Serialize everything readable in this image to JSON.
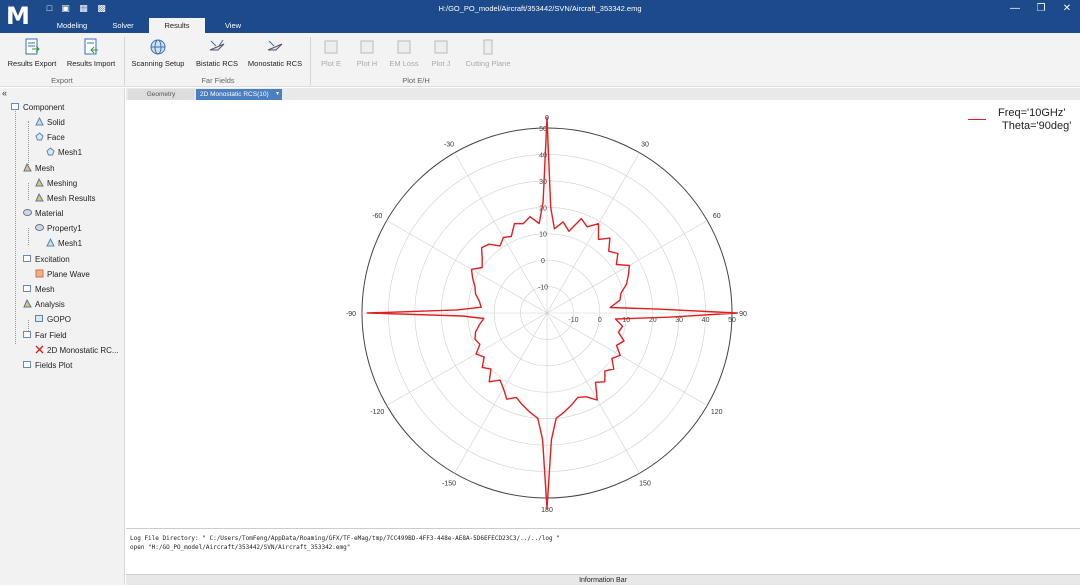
{
  "window": {
    "title": "H:/GO_PO_model/Aircraft/353442/SVN/Aircraft_353342.emg",
    "logo": "M"
  },
  "menu_tabs": [
    "Modeling",
    "Solver",
    "Results",
    "View"
  ],
  "active_tab": "Results",
  "ribbon": {
    "export": {
      "label": "Export",
      "buttons": [
        "Results Export",
        "Results Import"
      ]
    },
    "far_fields": {
      "label": "Far Fields",
      "buttons": [
        "Scanning Setup",
        "Bistatic RCS",
        "Monostatic RCS"
      ]
    },
    "plot_eh": {
      "label": "Plot E/H",
      "buttons": [
        "Plot E",
        "Plot H",
        "EM Loss",
        "Plot J",
        "Cutting Plane"
      ]
    }
  },
  "doc_tabs": [
    "Geometry",
    "2D Monostatic RCS(10)"
  ],
  "tree": [
    {
      "label": "Component",
      "icon": "component-icon"
    },
    {
      "label": "Solid",
      "icon": "solid-icon"
    },
    {
      "label": "Face",
      "icon": "face-icon"
    },
    {
      "label": "Mesh1",
      "icon": "mesh-icon"
    },
    {
      "label": "Mesh",
      "icon": "mesh-group-icon"
    },
    {
      "label": "Meshing",
      "icon": "meshing-icon"
    },
    {
      "label": "Mesh Results",
      "icon": "mesh-results-icon"
    },
    {
      "label": "Material",
      "icon": "material-icon"
    },
    {
      "label": "Property1",
      "icon": "property-icon"
    },
    {
      "label": "Mesh1",
      "icon": "mesh-icon"
    },
    {
      "label": "Excitation",
      "icon": "excitation-icon"
    },
    {
      "label": "Plane Wave",
      "icon": "plane-wave-icon"
    },
    {
      "label": "Mesh",
      "icon": "mesh-group-icon"
    },
    {
      "label": "Analysis",
      "icon": "analysis-icon"
    },
    {
      "label": "GOPO",
      "icon": "gopo-icon"
    },
    {
      "label": "Far Field",
      "icon": "far-field-icon"
    },
    {
      "label": "2D Monostatic RC...",
      "icon": "x-icon"
    },
    {
      "label": "Fields Plot",
      "icon": "fields-plot-icon"
    }
  ],
  "chart_data": {
    "type": "line",
    "coordinate_system": "polar",
    "angle_ticks": [
      "0",
      "30",
      "60",
      "90",
      "120",
      "150",
      "180",
      "-150",
      "-120",
      "-90",
      "-60",
      "-30"
    ],
    "radial_ticks": [
      "-10",
      "0",
      "10",
      "20",
      "30",
      "40",
      "50"
    ],
    "rlim": [
      -20,
      50
    ],
    "grid": true,
    "legend_position": "top-right",
    "legend_lines": [
      "Freq='10GHz'",
      "Theta='90deg'"
    ],
    "series": [
      {
        "color": "#e02020",
        "x": [
          0,
          2,
          5,
          10,
          15,
          20,
          25,
          30,
          35,
          40,
          45,
          50,
          55,
          60,
          65,
          70,
          75,
          80,
          85,
          88,
          90,
          92,
          95,
          100,
          105,
          110,
          115,
          120,
          125,
          130,
          135,
          140,
          145,
          150,
          155,
          160,
          165,
          170,
          175,
          178,
          180,
          182,
          185,
          190,
          195,
          200,
          205,
          210,
          215,
          220,
          225,
          230,
          235,
          240,
          245,
          250,
          255,
          260,
          265,
          268,
          270,
          272,
          275,
          280,
          285,
          290,
          295,
          300,
          305,
          310,
          315,
          320,
          325,
          330,
          335,
          340,
          345,
          350,
          355,
          358,
          360
        ],
        "y": [
          54,
          20,
          12,
          15,
          12,
          18,
          16,
          19,
          14,
          17,
          13,
          15,
          12,
          16,
          14,
          12,
          9,
          8,
          4,
          22,
          52,
          26,
          6,
          9,
          8,
          11,
          9,
          12,
          10,
          13,
          11,
          14,
          12,
          18,
          15,
          14,
          16,
          18,
          20,
          28,
          54,
          28,
          20,
          18,
          16,
          14,
          16,
          13,
          11,
          14,
          10,
          12,
          9,
          11,
          8,
          9,
          8,
          6,
          4,
          12,
          48,
          14,
          5,
          6,
          8,
          9,
          11,
          13,
          10,
          12,
          15,
          14,
          11,
          13,
          12,
          16,
          15,
          17,
          14,
          22,
          54
        ]
      }
    ]
  },
  "log": {
    "line1": "Log File Directory: \" C:/Users/TomFeng/AppData/Roaming/GFX/TF-eMag/tmp/7CC499BD-4FF3-448e-AE8A-5D6EFECD23C3/../../log \"",
    "line2": "open \"H:/GO_PO_model/Aircraft/353442/SVN/Aircraft_353342.emg\""
  },
  "info_bar": "Information Bar"
}
